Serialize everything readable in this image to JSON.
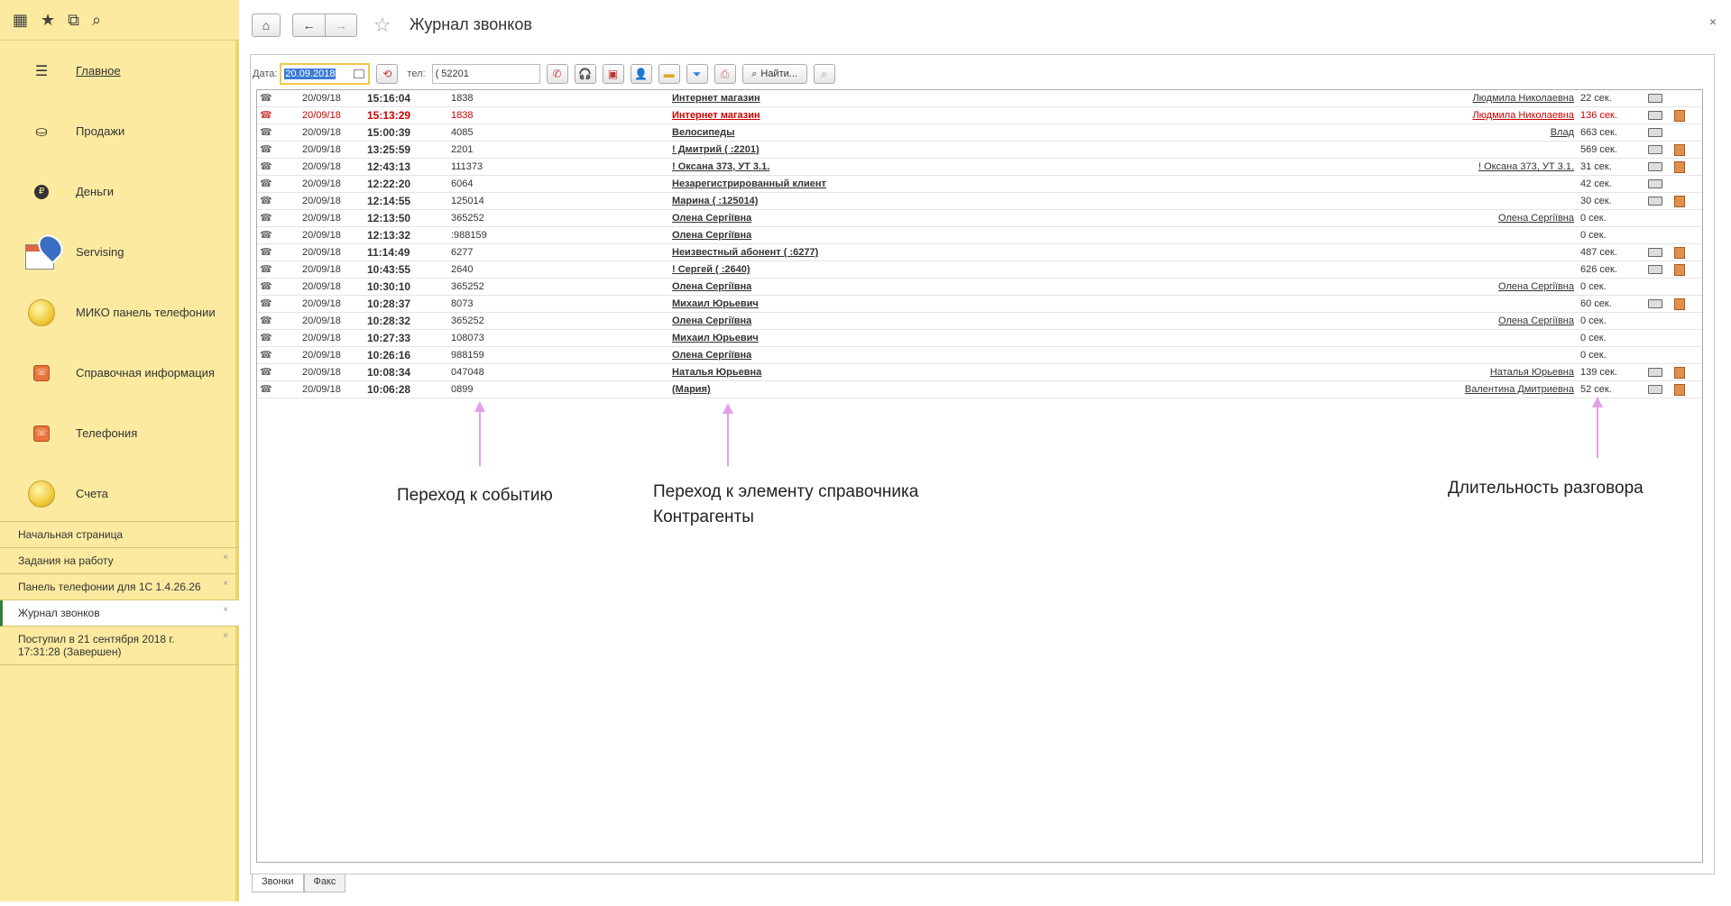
{
  "app": {
    "title": "Журнал звонков"
  },
  "nav": [
    {
      "label": "Главное",
      "icon": "menu-lines-icon",
      "active": true
    },
    {
      "label": "Продажи",
      "icon": "basket-icon"
    },
    {
      "label": "Деньги",
      "icon": "ruble-coin-icon"
    },
    {
      "label": "Servising",
      "icon": "calendar-pin-icon"
    },
    {
      "label": "МИКО панель телефонии",
      "icon": "gold-coin-icon"
    },
    {
      "label": "Справочная информация",
      "icon": "phone-book-icon"
    },
    {
      "label": "Телефония",
      "icon": "phone-book-icon"
    },
    {
      "label": "Счета",
      "icon": "gold-coin-icon"
    }
  ],
  "open_windows": [
    {
      "label": "Начальная страница"
    },
    {
      "label": "Задания на работу"
    },
    {
      "label": "Панель телефонии для 1С 1.4.26.26"
    },
    {
      "label": "Журнал звонков",
      "active": true
    },
    {
      "label": "Поступил в 21 сентября 2018 г. 17:31:28 (Завершен)"
    }
  ],
  "toolbar": {
    "date_label": "Дата:",
    "date_value": "20.09.2018",
    "phone_label": "тел:",
    "phone_value": "(              52201",
    "find_label": "Найти..."
  },
  "calls": [
    {
      "date": "20/09/18",
      "time": "15:16:04",
      "number": "1838",
      "contact": "Интернет магазин",
      "manager": "Людмила Николаевна",
      "duration": "22 сек.",
      "missed": false,
      "rec": true,
      "doc": false
    },
    {
      "date": "20/09/18",
      "time": "15:13:29",
      "number": "1838",
      "contact": "Интернет магазин",
      "manager": "Людмила Николаевна",
      "duration": "136 сек.",
      "missed": true,
      "rec": true,
      "doc": true
    },
    {
      "date": "20/09/18",
      "time": "15:00:39",
      "number": "4085",
      "contact": "Велосипеды",
      "manager": "Влад",
      "duration": "663 сек.",
      "missed": false,
      "rec": true,
      "doc": false
    },
    {
      "date": "20/09/18",
      "time": "13:25:59",
      "number": "2201",
      "contact": "! Дмитрий (             :2201)",
      "manager": "",
      "duration": "569 сек.",
      "missed": false,
      "rec": true,
      "doc": true
    },
    {
      "date": "20/09/18",
      "time": "12:43:13",
      "number": "111373",
      "contact": "! Оксана            373,  УТ 3.1.",
      "manager": "! Оксана            373,  УТ 3.1.",
      "duration": "31 сек.",
      "missed": false,
      "rec": true,
      "doc": true
    },
    {
      "date": "20/09/18",
      "time": "12:22:20",
      "number": "6064",
      "contact": "Незарегистрированный клиент",
      "manager": "",
      "duration": "42 сек.",
      "missed": false,
      "rec": true,
      "doc": false
    },
    {
      "date": "20/09/18",
      "time": "12:14:55",
      "number": "125014",
      "contact": "Марина (              :125014)",
      "manager": "",
      "duration": "30 сек.",
      "missed": false,
      "rec": true,
      "doc": true
    },
    {
      "date": "20/09/18",
      "time": "12:13:50",
      "number": "365252",
      "contact": "Олена Сергіївна",
      "manager": "Олена Сергіївна",
      "duration": "0 сек.",
      "missed": false,
      "rec": false,
      "doc": false
    },
    {
      "date": "20/09/18",
      "time": "12:13:32",
      "number": ":988159",
      "contact": "Олена Сергіївна",
      "manager": "",
      "duration": "0 сек.",
      "missed": false,
      "rec": false,
      "doc": false
    },
    {
      "date": "20/09/18",
      "time": "11:14:49",
      "number": "6277",
      "contact": "Неизвестный абонент (             :6277)",
      "manager": "",
      "duration": "487 сек.",
      "missed": false,
      "rec": true,
      "doc": true
    },
    {
      "date": "20/09/18",
      "time": "10:43:55",
      "number": "2640",
      "contact": "! Сергей (              :2640)",
      "manager": "",
      "duration": "626 сек.",
      "missed": false,
      "rec": true,
      "doc": true
    },
    {
      "date": "20/09/18",
      "time": "10:30:10",
      "number": "365252",
      "contact": "Олена Сергіївна",
      "manager": "Олена Сергіївна",
      "duration": "0 сек.",
      "missed": false,
      "rec": false,
      "doc": false
    },
    {
      "date": "20/09/18",
      "time": "10:28:37",
      "number": "8073",
      "contact": "Михаил Юрьевич",
      "manager": "",
      "duration": "60 сек.",
      "missed": false,
      "rec": true,
      "doc": true
    },
    {
      "date": "20/09/18",
      "time": "10:28:32",
      "number": "365252",
      "contact": "Олена Сергіївна",
      "manager": "Олена Сергіївна",
      "duration": "0 сек.",
      "missed": false,
      "rec": false,
      "doc": false
    },
    {
      "date": "20/09/18",
      "time": "10:27:33",
      "number": "108073",
      "contact": "Михаил Юрьевич",
      "manager": "",
      "duration": "0 сек.",
      "missed": false,
      "rec": false,
      "doc": false
    },
    {
      "date": "20/09/18",
      "time": "10:26:16",
      "number": "988159",
      "contact": "Олена Сергіївна",
      "manager": "",
      "duration": "0 сек.",
      "missed": false,
      "rec": false,
      "doc": false
    },
    {
      "date": "20/09/18",
      "time": "10:08:34",
      "number": "047048",
      "contact": "Наталья Юрьевна",
      "manager": "Наталья Юрьевна",
      "duration": "139 сек.",
      "missed": false,
      "rec": true,
      "doc": true
    },
    {
      "date": "20/09/18",
      "time": "10:06:28",
      "number": "0899",
      "contact": "(Мария)",
      "manager": "Валентина Дмитриевна",
      "duration": "52 сек.",
      "missed": false,
      "rec": true,
      "doc": true
    }
  ],
  "annotations": {
    "event": "Переход к событию",
    "directory": "Переход к элементу справочника Контрагенты",
    "duration": "Длительность разговора"
  },
  "tabs": [
    {
      "label": "Звонки",
      "active": true
    },
    {
      "label": "Факс"
    }
  ],
  "colors": {
    "sidebar_bg": "#fbeaa0",
    "missed_call": "#c00000",
    "accent_date": "#f0c94a"
  }
}
